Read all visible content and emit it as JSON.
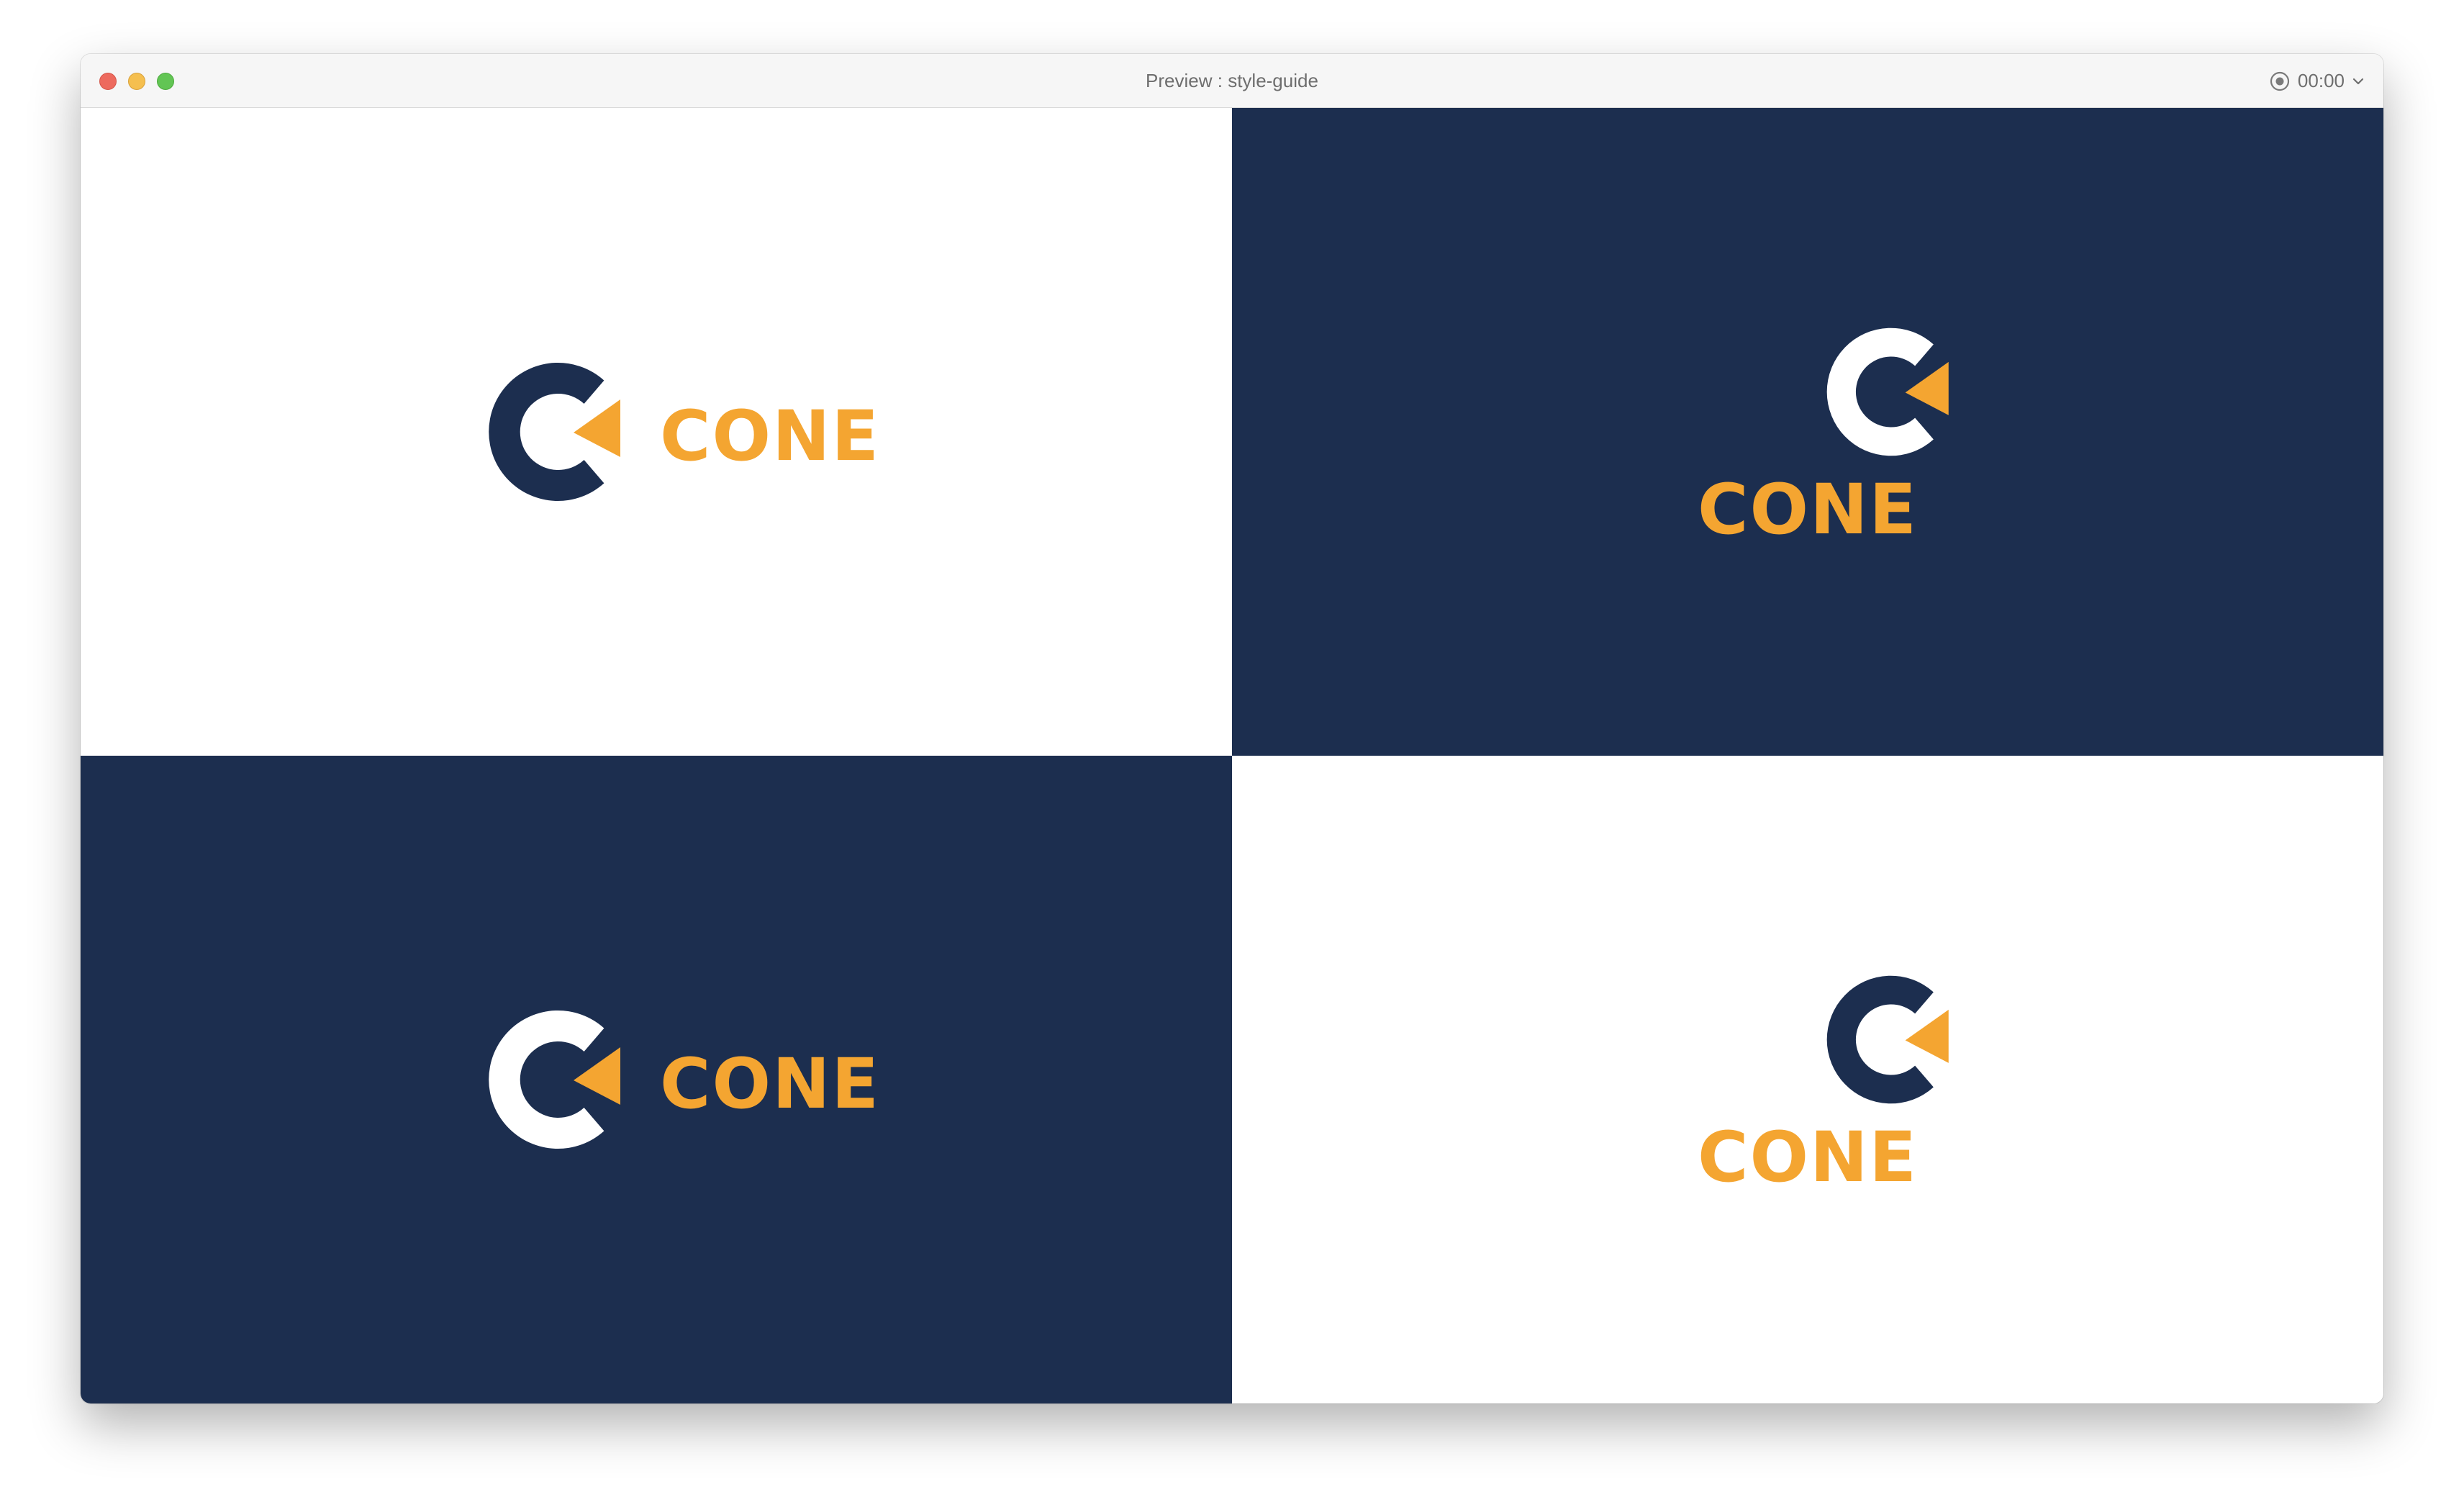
{
  "window": {
    "title": "Preview : style-guide",
    "timer": "00:00"
  },
  "colors": {
    "navy": "#1c2e4f",
    "orange": "#f4a531",
    "white": "#ffffff"
  },
  "variants": [
    {
      "layout": "horizontal",
      "background": "white",
      "mark_color": "navy",
      "wordmark": "CONE"
    },
    {
      "layout": "stacked",
      "background": "navy",
      "mark_color": "white",
      "wordmark": "CONE"
    },
    {
      "layout": "horizontal",
      "background": "navy",
      "mark_color": "white",
      "wordmark": "CONE"
    },
    {
      "layout": "stacked",
      "background": "white",
      "mark_color": "navy",
      "wordmark": "CONE"
    }
  ],
  "icons": {
    "record": "record-icon",
    "chevron": "chevron-down-icon"
  }
}
